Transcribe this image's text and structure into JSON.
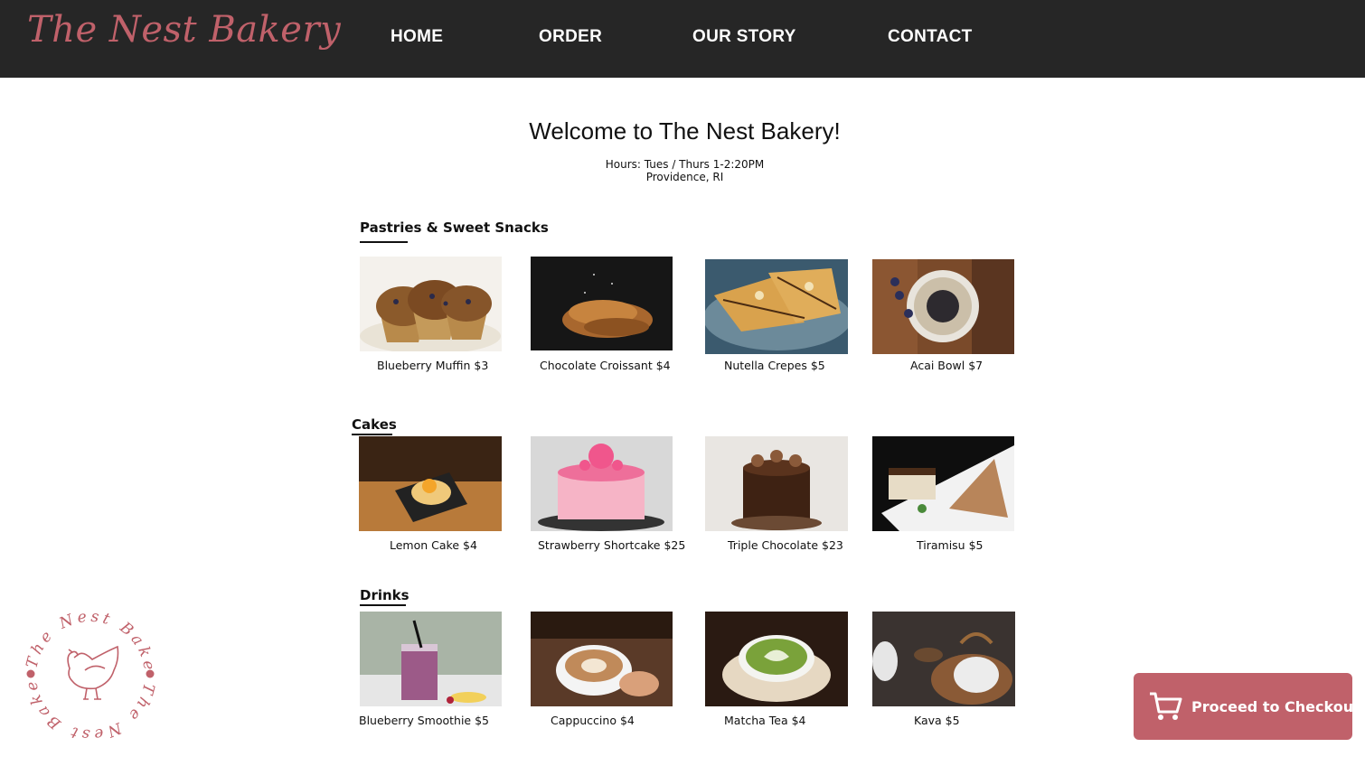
{
  "brand": {
    "name": "The Nest Bakery",
    "color": "#c0616a"
  },
  "nav": {
    "home": "HOME",
    "order": "ORDER",
    "story": "OUR STORY",
    "contact": "CONTACT"
  },
  "welcome": {
    "title": "Welcome to The Nest Bakery!",
    "hours": "Hours: Tues / Thurs 1-2:20PM",
    "location": "Providence, RI"
  },
  "sections": [
    {
      "title": "Pastries & Sweet Snacks",
      "items": [
        {
          "caption": "Blueberry Muffin $3",
          "icon": "blueberry-muffin-photo"
        },
        {
          "caption": "Chocolate Croissant $4",
          "icon": "croissant-photo"
        },
        {
          "caption": "Nutella Crepes $5",
          "icon": "crepes-photo"
        },
        {
          "caption": "Acai Bowl $7",
          "icon": "acai-bowl-photo"
        }
      ]
    },
    {
      "title": "Cakes",
      "items": [
        {
          "caption": "Lemon Cake $4",
          "icon": "lemon-cake-photo"
        },
        {
          "caption": "Strawberry Shortcake $25",
          "icon": "strawberry-cake-photo"
        },
        {
          "caption": "Triple Chocolate $23",
          "icon": "chocolate-cake-photo"
        },
        {
          "caption": "Tiramisu $5",
          "icon": "tiramisu-photo"
        }
      ]
    },
    {
      "title": "Drinks",
      "items": [
        {
          "caption": "Blueberry Smoothie $5",
          "icon": "smoothie-photo"
        },
        {
          "caption": "Cappuccino $4",
          "icon": "cappuccino-photo"
        },
        {
          "caption": "Matcha Tea $4",
          "icon": "matcha-photo"
        },
        {
          "caption": "Kava $5",
          "icon": "kava-photo"
        }
      ]
    }
  ],
  "stamp": {
    "top_text": "The Nest Bakery",
    "bottom_text": "The Nest Bakery"
  },
  "checkout": {
    "label": "Proceed to Checkout",
    "color": "#c0616a"
  }
}
